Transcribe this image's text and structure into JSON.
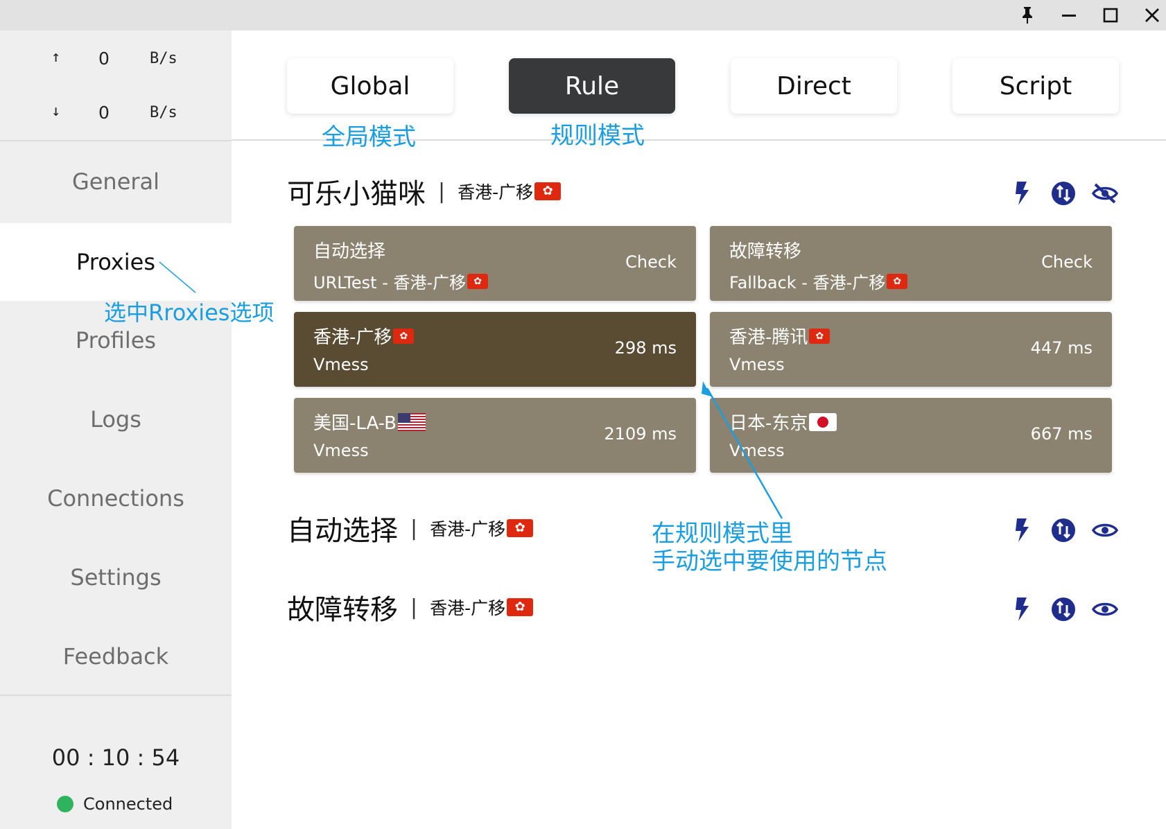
{
  "window": {
    "pin_icon": "pin-icon",
    "minimize_icon": "minimize-icon",
    "maximize_icon": "maximize-icon",
    "close_icon": "close-icon"
  },
  "traffic": {
    "up_arrow": "↑",
    "up_value": "0",
    "up_unit": "B/s",
    "down_arrow": "↓",
    "down_value": "0",
    "down_unit": "B/s"
  },
  "nav": {
    "items": [
      "General",
      "Proxies",
      "Profiles",
      "Logs",
      "Connections",
      "Settings",
      "Feedback"
    ],
    "active": "Proxies"
  },
  "status": {
    "timer": "00 : 10 : 54",
    "state": "Connected",
    "dot_color": "#2fb35f"
  },
  "modes": {
    "items": [
      "Global",
      "Rule",
      "Direct",
      "Script"
    ],
    "active": "Rule"
  },
  "groups": [
    {
      "name": "可乐小猫咪",
      "selected": "香港-广移",
      "expanded": true,
      "proxies": [
        {
          "name": "自动选择",
          "type": "URLTest - 香港-广移",
          "right": "Check",
          "flag": "hk",
          "type_flag": "hk"
        },
        {
          "name": "故障转移",
          "type": "Fallback - 香港-广移",
          "right": "Check",
          "flag": "",
          "type_flag": "hk"
        },
        {
          "name": "香港-广移",
          "type": "Vmess",
          "right": "298 ms",
          "flag": "hk",
          "selected": true
        },
        {
          "name": "香港-腾讯",
          "type": "Vmess",
          "right": "447 ms",
          "flag": "hk"
        },
        {
          "name": "美国-LA-B",
          "type": "Vmess",
          "right": "2109 ms",
          "flag": "us"
        },
        {
          "name": "日本-东京",
          "type": "Vmess",
          "right": "667 ms",
          "flag": "jp"
        }
      ]
    },
    {
      "name": "自动选择",
      "selected": "香港-广移",
      "expanded": false
    },
    {
      "name": "故障转移",
      "selected": "香港-广移",
      "expanded": false
    }
  ],
  "annotations": {
    "global": "全局模式",
    "rule": "规则模式",
    "proxies": "选中Rroxies选项",
    "node_line1": "在规则模式里",
    "node_line2": "手动选中要使用的节点",
    "color": "#1a9ee0"
  }
}
